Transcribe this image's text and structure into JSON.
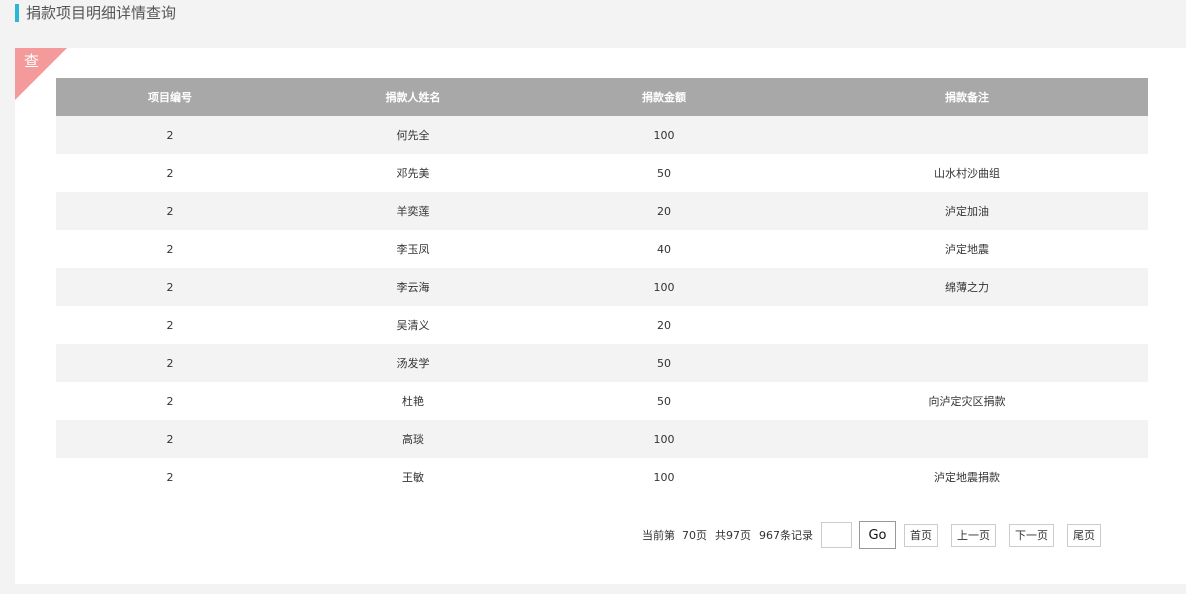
{
  "page": {
    "title": "捐款项目明细详情查询"
  },
  "panel": {
    "corner_label": "查"
  },
  "table": {
    "headers": [
      "项目编号",
      "捐款人姓名",
      "捐款金额",
      "捐款备注"
    ],
    "rows": [
      [
        "2",
        "何先全",
        "100",
        ""
      ],
      [
        "2",
        "邓先美",
        "50",
        "山水村沙曲组"
      ],
      [
        "2",
        "羊奕莲",
        "20",
        "泸定加油"
      ],
      [
        "2",
        "李玉凤",
        "40",
        "泸定地震"
      ],
      [
        "2",
        "李云海",
        "100",
        "绵薄之力"
      ],
      [
        "2",
        "吴清义",
        "20",
        ""
      ],
      [
        "2",
        "汤发学",
        "50",
        ""
      ],
      [
        "2",
        "杜艳",
        "50",
        "向泸定灾区捐款"
      ],
      [
        "2",
        "高琰",
        "100",
        ""
      ],
      [
        "2",
        "王敏",
        "100",
        "泸定地震捐款"
      ]
    ]
  },
  "pager": {
    "current_text": "当前第  70页",
    "total_pages_text": "共97页",
    "records_text": "967条记录",
    "go_input_value": "",
    "go_label": "Go",
    "first_label": "首页",
    "prev_label": "上一页",
    "next_label": "下一页",
    "last_label": "尾页"
  },
  "colors": {
    "accent_bar": "#2bb5d6",
    "corner": "#f49a9a",
    "header_bg": "#a8a8a8"
  }
}
